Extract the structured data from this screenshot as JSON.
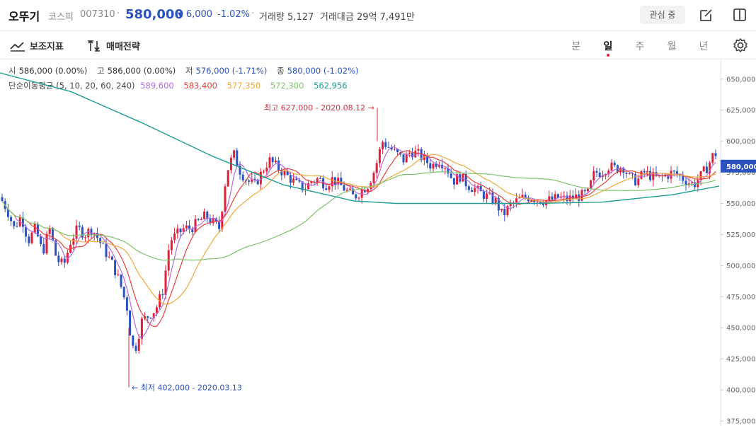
{
  "header": {
    "stock_name": "오뚜기",
    "market": "코스피",
    "code": "007310",
    "separator": "·",
    "price": "580,000",
    "change_arrow": "▼",
    "change": "6,000",
    "change_pct": "-1.02%",
    "volume_label": "거래량",
    "volume": "5,127",
    "amount_label": "거래대금",
    "amount": "29억 7,491만",
    "watch_label": "관심 중",
    "icons": [
      "edit-icon",
      "split-panel-icon"
    ],
    "down_color": "#2a53c1"
  },
  "toolbar": {
    "indicator_label": "보조지표",
    "strategy_label": "매매전략",
    "periods": [
      "분",
      "일",
      "주",
      "월",
      "년"
    ],
    "active_period": "일",
    "icons": [
      "indicator-icon",
      "strategy-icon",
      "settings-icon"
    ]
  },
  "ohlc": {
    "open_label": "시",
    "open": "586,000 (0.00%)",
    "high_label": "고",
    "high": "586,000 (0.00%)",
    "low_label": "저",
    "low": "576,000 (-1.71%)",
    "close_label": "종",
    "close": "580,000 (-1.02%)"
  },
  "ma_legend": {
    "title": "단순이동평균 (5, 10, 20, 60, 240)",
    "values": [
      {
        "value": "589,600",
        "color": "#b36ae2"
      },
      {
        "value": "583,400",
        "color": "#e8413b"
      },
      {
        "value": "577,350",
        "color": "#f2a83b"
      },
      {
        "value": "572,300",
        "color": "#7cc36a"
      },
      {
        "value": "562,956",
        "color": "#1f9c96"
      }
    ]
  },
  "chart_data": {
    "type": "candlestick",
    "ylim": [
      375000,
      655000
    ],
    "y_ticks": [
      "650,000",
      "625,000",
      "600,000",
      "575,000",
      "550,000",
      "525,000",
      "500,000",
      "475,000",
      "450,000",
      "425,000",
      "400,000",
      "375,000"
    ],
    "y_tick_values": [
      650000,
      625000,
      600000,
      575000,
      550000,
      525000,
      500000,
      475000,
      450000,
      425000,
      400000,
      375000
    ],
    "current_price": 580000,
    "current_price_label": "580,000",
    "annotations": {
      "high_text": "최고 627,000 - 2020.08.12",
      "high_value": 627000,
      "low_text": "← 최저 402,000 - 2020.03.13",
      "low_value": 402000
    },
    "colors": {
      "up": "#e0203a",
      "down": "#2a53c1"
    },
    "anchors": [
      [
        0,
        555000
      ],
      [
        10,
        545000
      ],
      [
        20,
        530000
      ],
      [
        30,
        540000
      ],
      [
        40,
        520000
      ],
      [
        50,
        530000
      ],
      [
        60,
        510000
      ],
      [
        70,
        530000
      ],
      [
        80,
        505000
      ],
      [
        90,
        500000
      ],
      [
        100,
        520000
      ],
      [
        110,
        530000
      ],
      [
        120,
        525000
      ],
      [
        130,
        530000
      ],
      [
        140,
        520000
      ],
      [
        150,
        510000
      ],
      [
        160,
        500000
      ],
      [
        170,
        485000
      ],
      [
        180,
        465000
      ],
      [
        185,
        440000
      ],
      [
        190,
        430000
      ],
      [
        200,
        455000
      ],
      [
        210,
        460000
      ],
      [
        220,
        465000
      ],
      [
        230,
        480000
      ],
      [
        240,
        520000
      ],
      [
        250,
        525000
      ],
      [
        260,
        530000
      ],
      [
        270,
        530000
      ],
      [
        280,
        535000
      ],
      [
        290,
        540000
      ],
      [
        300,
        535000
      ],
      [
        310,
        530000
      ],
      [
        320,
        575000
      ],
      [
        330,
        590000
      ],
      [
        340,
        575000
      ],
      [
        350,
        568000
      ],
      [
        360,
        565000
      ],
      [
        370,
        575000
      ],
      [
        380,
        585000
      ],
      [
        390,
        580000
      ],
      [
        400,
        575000
      ],
      [
        410,
        570000
      ],
      [
        420,
        565000
      ],
      [
        430,
        562000
      ],
      [
        440,
        568000
      ],
      [
        450,
        570000
      ],
      [
        460,
        565000
      ],
      [
        470,
        570000
      ],
      [
        480,
        565000
      ],
      [
        490,
        560000
      ],
      [
        500,
        555000
      ],
      [
        510,
        560000
      ],
      [
        520,
        565000
      ],
      [
        530,
        578000
      ],
      [
        540,
        600000
      ],
      [
        550,
        595000
      ],
      [
        560,
        590000
      ],
      [
        570,
        585000
      ],
      [
        580,
        592000
      ],
      [
        590,
        590000
      ],
      [
        600,
        585000
      ],
      [
        610,
        580000
      ],
      [
        620,
        585000
      ],
      [
        630,
        580000
      ],
      [
        640,
        568000
      ],
      [
        650,
        572000
      ],
      [
        660,
        565000
      ],
      [
        670,
        562000
      ],
      [
        680,
        558000
      ],
      [
        690,
        555000
      ],
      [
        700,
        552000
      ],
      [
        710,
        540000
      ],
      [
        720,
        548000
      ],
      [
        730,
        552000
      ],
      [
        740,
        555000
      ],
      [
        750,
        555000
      ],
      [
        760,
        553000
      ],
      [
        770,
        552000
      ],
      [
        780,
        553000
      ],
      [
        790,
        555000
      ],
      [
        800,
        553000
      ],
      [
        810,
        555000
      ],
      [
        820,
        556000
      ],
      [
        830,
        558000
      ],
      [
        840,
        575000
      ],
      [
        850,
        575000
      ],
      [
        860,
        580000
      ],
      [
        870,
        578000
      ],
      [
        880,
        580000
      ],
      [
        890,
        570000
      ],
      [
        900,
        568000
      ],
      [
        910,
        575000
      ],
      [
        920,
        572000
      ],
      [
        930,
        570000
      ],
      [
        940,
        572000
      ],
      [
        950,
        575000
      ],
      [
        960,
        572000
      ],
      [
        970,
        568000
      ],
      [
        980,
        565000
      ],
      [
        990,
        572000
      ],
      [
        1000,
        580000
      ],
      [
        1010,
        592000
      ],
      [
        1016,
        580000
      ]
    ],
    "ma_colors": [
      "#b36ae2",
      "#e8413b",
      "#f2a83b",
      "#7cc36a",
      "#1f9c96"
    ]
  }
}
